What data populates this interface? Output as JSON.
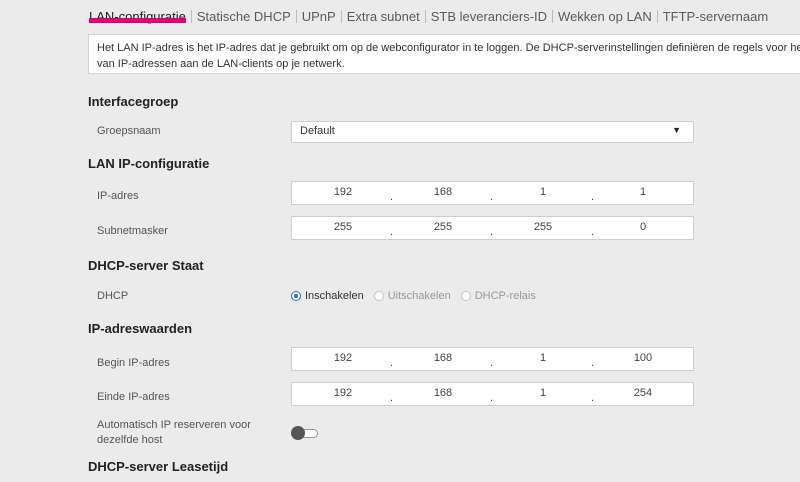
{
  "tabs": [
    {
      "label": "LAN-configuratie",
      "active": true
    },
    {
      "label": "Statische DHCP"
    },
    {
      "label": "UPnP"
    },
    {
      "label": "Extra subnet"
    },
    {
      "label": "STB leveranciers-ID"
    },
    {
      "label": "Wekken op LAN"
    },
    {
      "label": "TFTP-servernaam"
    }
  ],
  "info": {
    "line1": "Het LAN IP-adres is het IP-adres dat je gebruikt om op de webconfigurator in te loggen. De DHCP-serverinstellingen definiëren de regels voor het toewijzen",
    "line2": "van IP-adressen aan de LAN-clients op je netwerk."
  },
  "interface_group": {
    "title": "Interfacegroep",
    "group_name_label": "Groepsnaam",
    "group_name_value": "Default"
  },
  "lan_ip": {
    "title": "LAN IP-configuratie",
    "ip_label": "IP-adres",
    "ip": [
      "192",
      "168",
      "1",
      "1"
    ],
    "mask_label": "Subnetmasker",
    "mask": [
      "255",
      "255",
      "255",
      "0"
    ]
  },
  "dhcp_state": {
    "title": "DHCP-server Staat",
    "label": "DHCP",
    "options": [
      "Inschakelen",
      "Uitschakelen",
      "DHCP-relais"
    ],
    "selected": "Inschakelen"
  },
  "ip_range": {
    "title": "IP-adreswaarden",
    "begin_label": "Begin IP-adres",
    "begin": [
      "192",
      "168",
      "1",
      "100"
    ],
    "end_label": "Einde IP-adres",
    "end": [
      "192",
      "168",
      "1",
      "254"
    ],
    "auto_reserve_label_1": "Automatisch IP reserveren voor",
    "auto_reserve_label_2": "dezelfde host",
    "auto_reserve_enabled": false
  },
  "lease": {
    "title": "DHCP-server Leasetijd"
  },
  "colors": {
    "accent": "#e2007a",
    "radio": "#1a73e8",
    "background": "#ebebeb"
  },
  "icons": {
    "dropdown": "chevron-down-icon"
  }
}
